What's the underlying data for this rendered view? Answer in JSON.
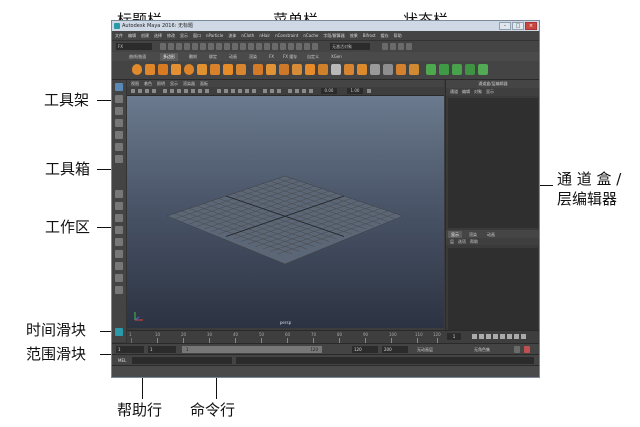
{
  "callouts": {
    "title_bar": "标题栏",
    "menu_bar": "菜单栏",
    "status_line": "状态栏",
    "shelf": "工具架",
    "toolbox": "工具箱",
    "workspace": "工作区",
    "channel_box": "通 道 盒 /",
    "layer_editor": "层编辑器",
    "time_slider": "时间滑块",
    "range_slider": "范围滑块",
    "help_line": "帮助行",
    "command_line": "命令行"
  },
  "window": {
    "title": "Autodesk Maya 2016: 无标题",
    "minimize": "–",
    "maximize": "□",
    "close": "×"
  },
  "menu_items": [
    "文件",
    "编辑",
    "创建",
    "选择",
    "修改",
    "显示",
    "窗口",
    "nParticle",
    "流体",
    "nCloth",
    "nHair",
    "nConstraint",
    "nCache",
    "字段/解算器",
    "效果",
    "Bifrost",
    "缓存",
    "帮助"
  ],
  "status_line": {
    "mode": "FX",
    "input_placeholder": "无激活对象"
  },
  "shelf": {
    "tabs": [
      "曲线/曲面",
      "多边形",
      "雕刻",
      "绑定",
      "动画",
      "渲染",
      "FX",
      "FX 缓存",
      "自定义",
      "XGen"
    ],
    "active_tab": 1
  },
  "viewport": {
    "menu": [
      "视图",
      "着色",
      "照明",
      "显示",
      "渲染器",
      "面板"
    ],
    "field_a": "0.00",
    "field_b": "1.00",
    "camera_label": "persp"
  },
  "channel_box": {
    "title": "通道盒/层编辑器",
    "menu": [
      "通道",
      "编辑",
      "对象",
      "显示"
    ]
  },
  "layer_editor": {
    "tabs": [
      "显示",
      "渲染",
      "动画"
    ],
    "menu": [
      "层",
      "选项",
      "帮助"
    ]
  },
  "time_slider": {
    "ticks": [
      "1",
      "5",
      "10",
      "15",
      "20",
      "25",
      "30",
      "35",
      "40",
      "45",
      "50",
      "55",
      "60",
      "65",
      "70",
      "75",
      "80",
      "85",
      "90",
      "95",
      "100",
      "105",
      "110",
      "115",
      "120"
    ],
    "current_frame": "1"
  },
  "range_slider": {
    "start": "1",
    "range_start": "1",
    "bar_start": "1",
    "bar_end": "120",
    "range_end": "120",
    "end": "200",
    "anim_layer": "无动画层",
    "char_set": "无角色集"
  },
  "command_line": {
    "lang": "MEL"
  }
}
